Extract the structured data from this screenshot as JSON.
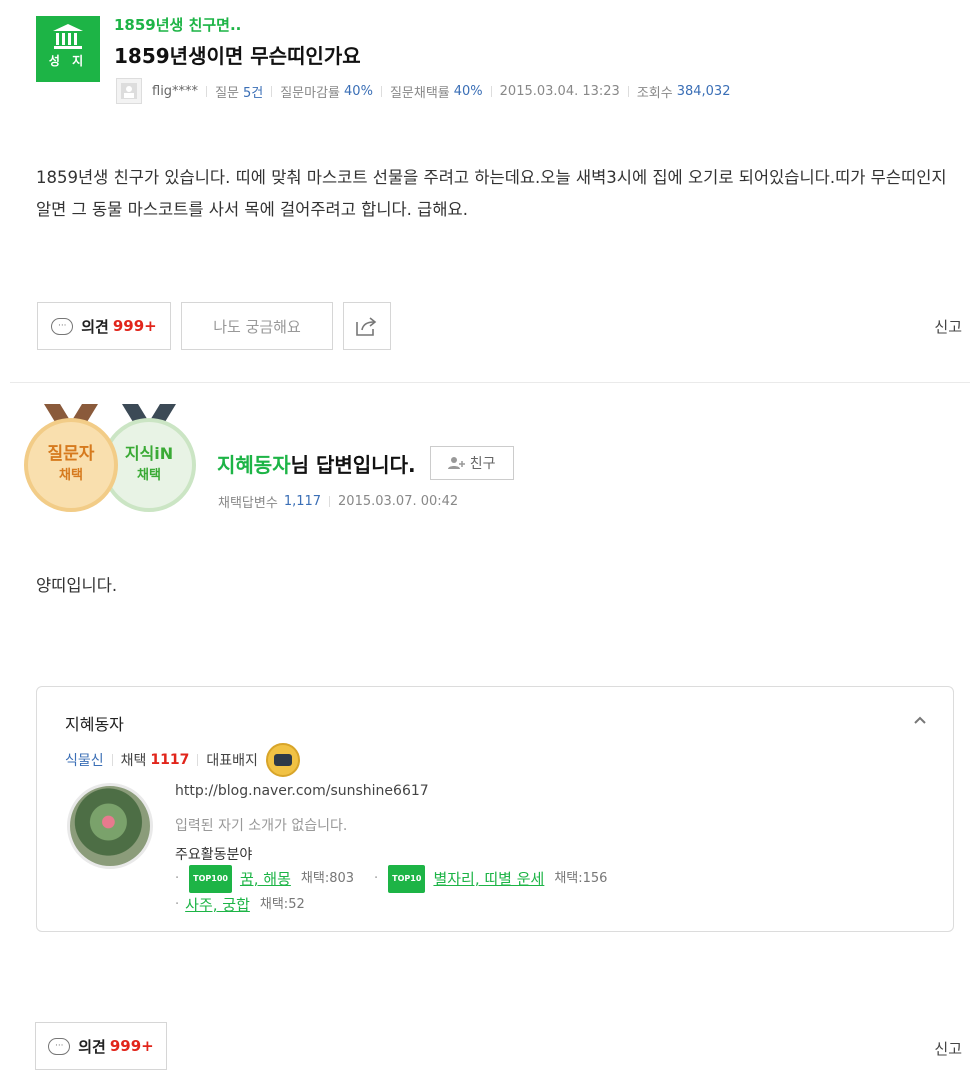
{
  "question": {
    "badge_label": "성 지",
    "badge_icon": "pillar-icon",
    "category": "1859년생 친구면..",
    "title": "1859년생이면 무슨띠인가요",
    "meta": {
      "user": "flig****",
      "questions_label": "질문",
      "questions_value": "5건",
      "closing_rate_label": "질문마감률",
      "closing_rate_value": "40%",
      "adoption_rate_label": "질문채택률",
      "adoption_rate_value": "40%",
      "date": "2015.03.04. 13:23",
      "views_label": "조회수",
      "views_value": "384,032"
    },
    "body": "1859년생 친구가 있습니다. 띠에 맞춰 마스코트 선물을 주려고 하는데요.오늘 새벽3시에 집에 오기로 되어있습니다.띠가 무슨띠인지 알면 그 동물 마스코트를 사서 목에 걸어주려고 합니다. 급해요."
  },
  "actions": {
    "opinion_label": "의견",
    "opinion_count": "999+",
    "curious_label": "나도 궁금해요",
    "report_label": "신고"
  },
  "answer": {
    "medal_questioner_line1": "질문자",
    "medal_questioner_line2": "채택",
    "medal_kin_line1": "지식iN",
    "medal_kin_line2": "채택",
    "author": "지혜동자",
    "author_suffix": "님 답변입니다.",
    "friend_label": "친구",
    "adopted_count_label": "채택답변수",
    "adopted_count_value": "1,117",
    "date": "2015.03.07. 00:42",
    "body": "양띠입니다."
  },
  "profile": {
    "name": "지혜동자",
    "rank": "식물신",
    "adopt_label": "채택",
    "adopt_value": "1117",
    "badge_label": "대표배지",
    "url": "http://blog.naver.com/sunshine6617",
    "intro": "입력된 자기 소개가 없습니다.",
    "fields_label": "주요활동분야",
    "fields": [
      {
        "tag": "TOP100",
        "name": "꿈, 해몽",
        "count": "채택:803"
      },
      {
        "tag": "TOP10",
        "name": "별자리, 띠별 운세",
        "count": "채택:156"
      },
      {
        "tag": "",
        "name": "사주, 궁합",
        "count": "채택:52"
      }
    ]
  },
  "actions2": {
    "opinion_label": "의견",
    "opinion_count": "999+",
    "report_label": "신고"
  },
  "colors": {
    "accent_green": "#1db446",
    "count_red": "#e1251b",
    "meta_blue": "#3b6fb6"
  }
}
